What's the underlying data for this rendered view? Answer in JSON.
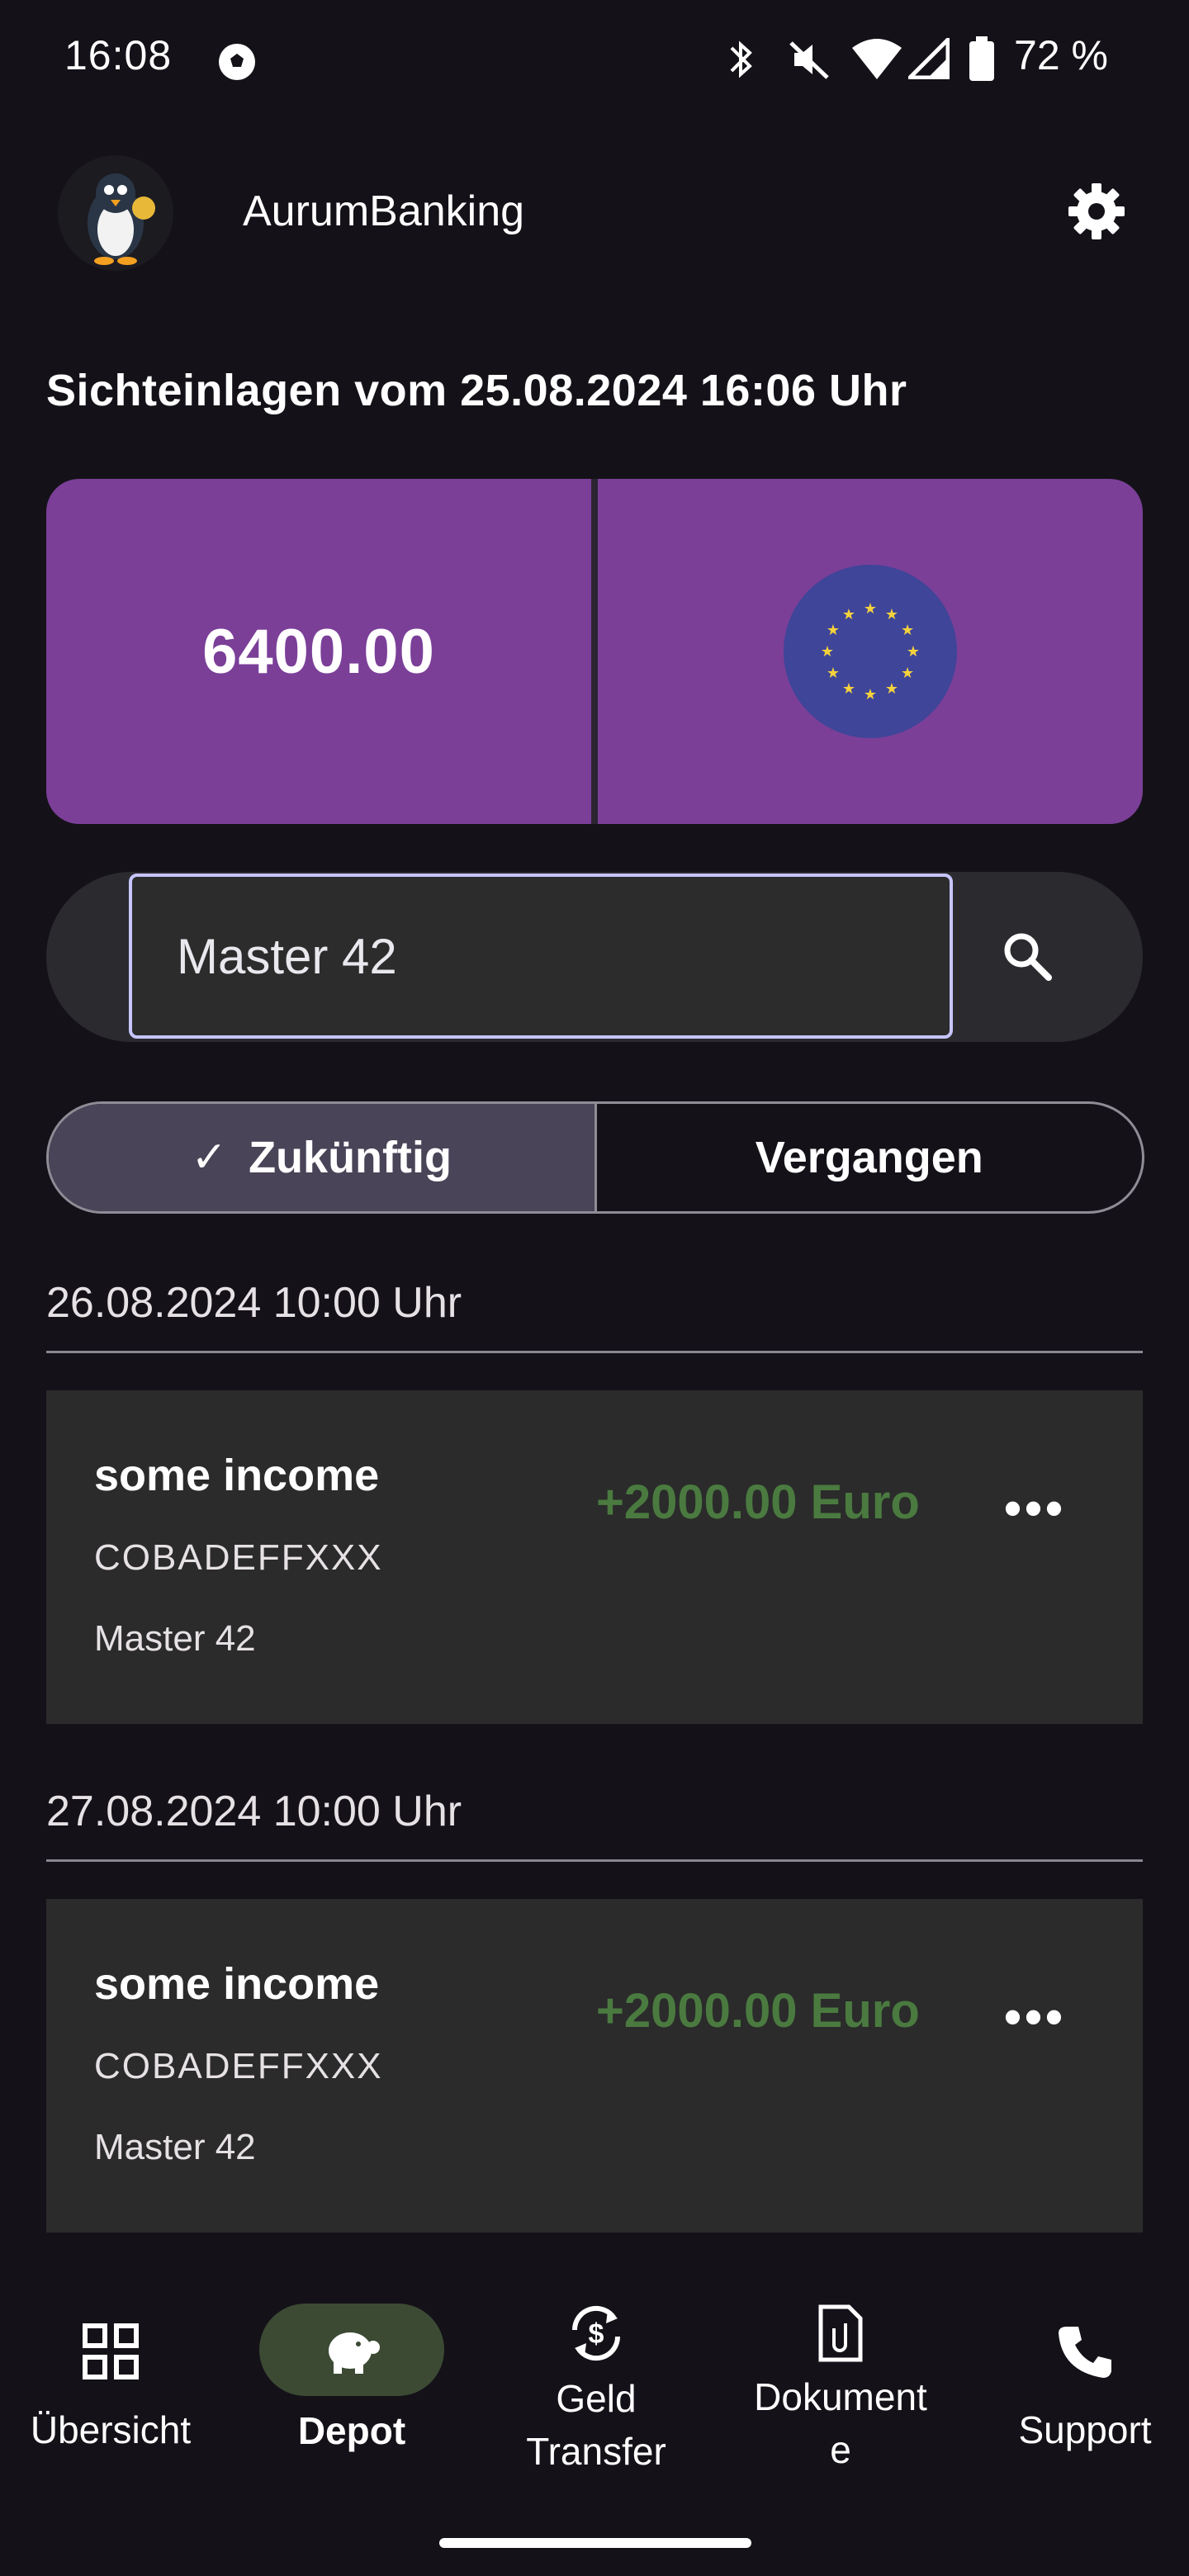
{
  "status_bar": {
    "time": "16:08",
    "battery": "72 %"
  },
  "header": {
    "app_title": "AurumBanking"
  },
  "section_title": "Sichteinlagen vom 25.08.2024 16:06 Uhr",
  "balance": {
    "amount": "6400.00",
    "currency_icon": "eu-flag-icon"
  },
  "search": {
    "value": "Master 42"
  },
  "segmented": {
    "future": "Zukünftig",
    "past": "Vergangen"
  },
  "transactions": [
    {
      "date": "26.08.2024 10:00 Uhr",
      "title": "some income",
      "bic": "COBADEFFXXX",
      "reference": "Master 42",
      "amount": "+2000.00 Euro"
    },
    {
      "date": "27.08.2024 10:00 Uhr",
      "title": "some income",
      "bic": "COBADEFFXXX",
      "reference": "Master 42",
      "amount": "+2000.00 Euro"
    }
  ],
  "nav": {
    "overview": "Übersicht",
    "depot": "Depot",
    "transfer_1": "Geld",
    "transfer_2": "Transfer",
    "documents_1": "Dokument",
    "documents_2": "e",
    "support": "Support"
  },
  "colors": {
    "accent_purple": "#7b3f98",
    "income_green": "#4a7a3f",
    "eu_blue": "#3f4599"
  }
}
